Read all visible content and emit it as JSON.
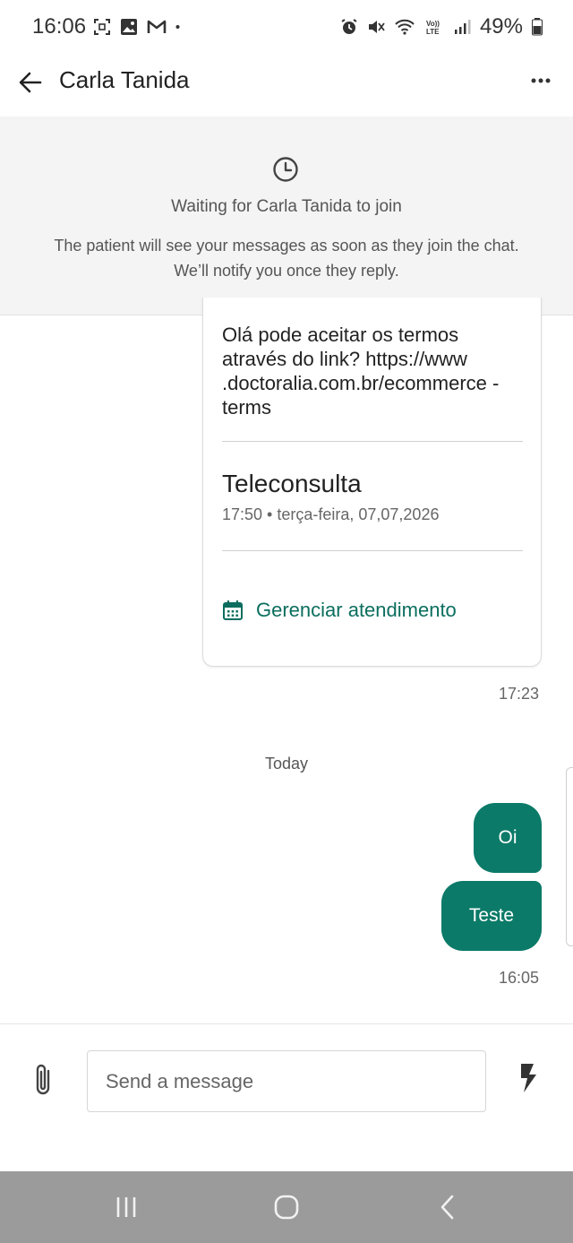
{
  "status_bar": {
    "time": "16:06",
    "battery": "49%",
    "icons_left": [
      "screenshot-icon",
      "image-icon",
      "gmail-icon",
      "dot-icon"
    ],
    "icons_right": [
      "alarm-icon",
      "mute-icon",
      "wifi-icon",
      "volte-icon",
      "signal-icon",
      "battery-icon"
    ]
  },
  "header": {
    "title": "Carla Tanida"
  },
  "waiting": {
    "title": "Waiting for Carla Tanida to join",
    "description": "The patient will see your messages as soon as they join the chat. We’ll notify you once they reply."
  },
  "appointment_card": {
    "message": "Olá pode aceitar os termos através do link? https://www .doctoralia.com.br/ecommerce -terms",
    "title": "Teleconsulta",
    "datetime": "17:50 • terça-feira, 07,07,2026",
    "manage_label": "Gerenciar atendimento",
    "time": "17:23"
  },
  "day_separator": "Today",
  "messages": [
    {
      "text": "Oi"
    },
    {
      "text": "Teste"
    }
  ],
  "last_message_time": "16:05",
  "composer": {
    "placeholder": "Send a message",
    "value": ""
  },
  "colors": {
    "accent": "#0b7a68",
    "link": "#0b6e5e",
    "panel_bg": "#f4f4f4",
    "nav_bg": "#9b9b9b"
  }
}
